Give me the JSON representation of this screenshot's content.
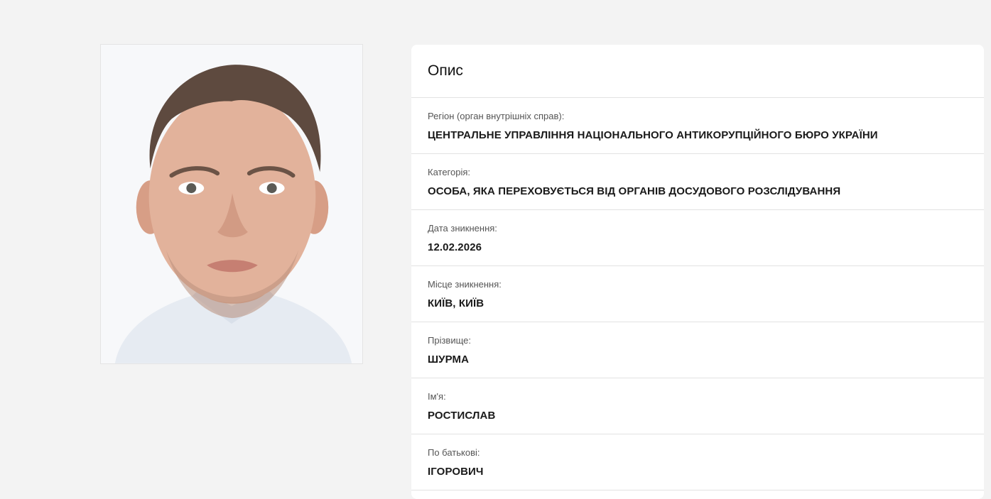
{
  "photo": {
    "icon": "person-portrait-photo",
    "background": "#f7f8fa"
  },
  "card": {
    "title": "Опис",
    "fields": [
      {
        "label": "Регіон (орган внутрішніх справ):",
        "value": "ЦЕНТРАЛЬНЕ УПРАВЛІННЯ НАЦІОНАЛЬНОГО АНТИКОРУПЦІЙНОГО БЮРО УКРАЇНИ"
      },
      {
        "label": "Категорія:",
        "value": "ОСОБА, ЯКА ПЕРЕХОВУЄТЬСЯ ВІД ОРГАНІВ ДОСУДОВОГО РОЗСЛІДУВАННЯ"
      },
      {
        "label": "Дата зникнення:",
        "value": "12.02.2026"
      },
      {
        "label": "Місце зникнення:",
        "value": "КИЇВ, КИЇВ"
      },
      {
        "label": "Прізвище:",
        "value": "ШУРМА"
      },
      {
        "label": "Ім'я:",
        "value": "РОСТИСЛАВ"
      },
      {
        "label": "По батькові:",
        "value": "ІГОРОВИЧ"
      }
    ]
  },
  "colors": {
    "page_background": "#f3f3f3",
    "card_background": "#ffffff",
    "divider": "#e2e2e2",
    "label_text": "#555555",
    "value_text": "#1a1a1a"
  }
}
